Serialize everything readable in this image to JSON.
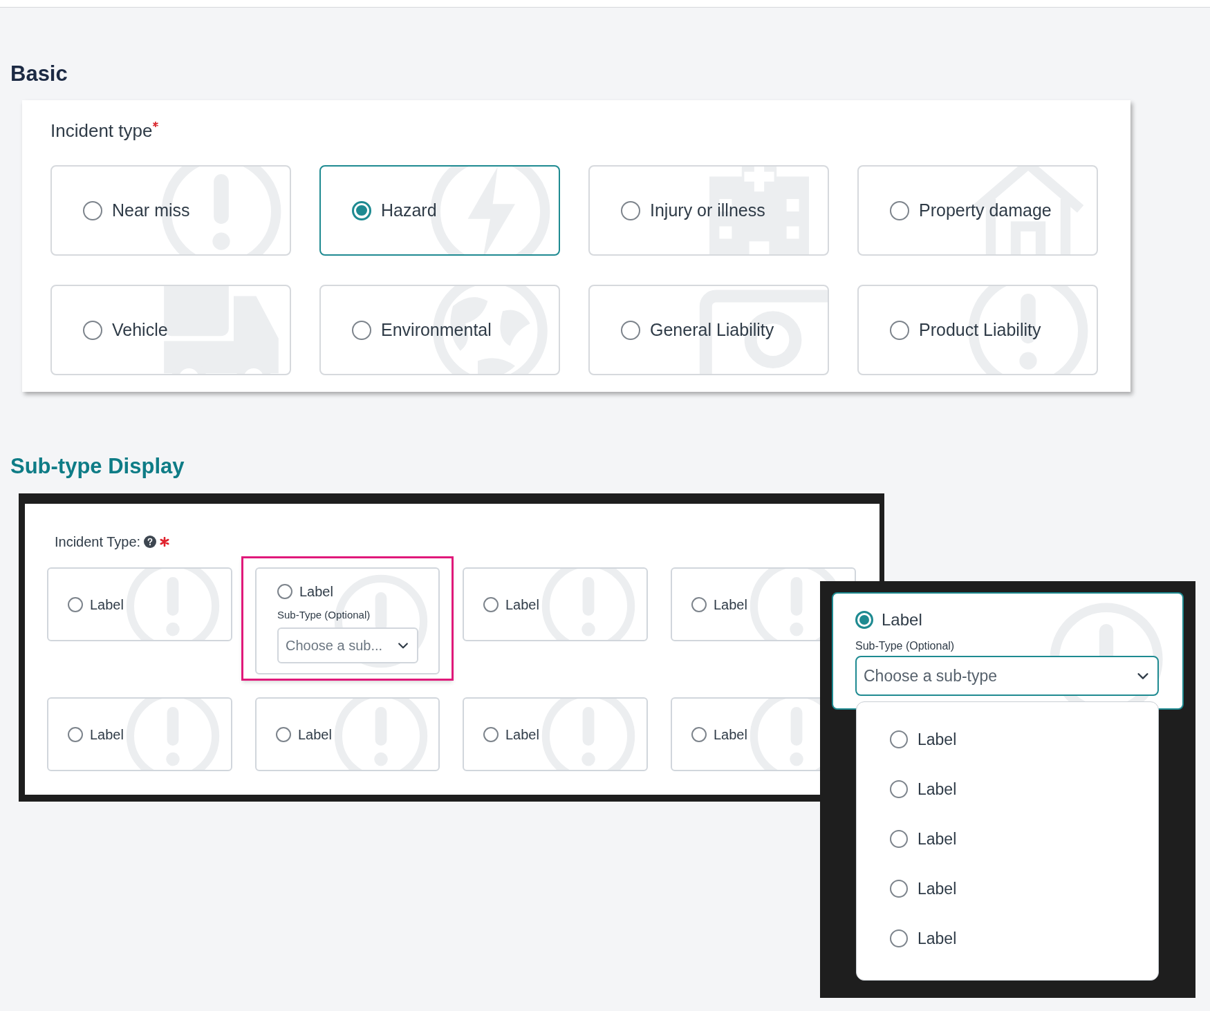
{
  "basic": {
    "heading": "Basic",
    "field": {
      "label": "Incident type",
      "required": true
    },
    "options": [
      {
        "label": "Near miss",
        "selected": false
      },
      {
        "label": "Hazard",
        "selected": true
      },
      {
        "label": "Injury or illness",
        "selected": false
      },
      {
        "label": "Property damage",
        "selected": false
      },
      {
        "label": "Vehicle",
        "selected": false
      },
      {
        "label": "Environmental",
        "selected": false
      },
      {
        "label": "General Liability",
        "selected": false
      },
      {
        "label": "Product Liability",
        "selected": false
      }
    ]
  },
  "subtype_display": {
    "heading": "Sub-type Display",
    "field": {
      "label": "Incident Type:",
      "required": true,
      "help": true
    },
    "options": [
      {
        "label": "Label",
        "selected": false
      },
      {
        "label": "Label",
        "selected": false,
        "highlighted": true,
        "subtype": {
          "label": "Sub-Type (Optional)",
          "placeholder": "Choose a sub..."
        }
      },
      {
        "label": "Label",
        "selected": false
      },
      {
        "label": "Label",
        "selected": false
      },
      {
        "label": "Label",
        "selected": false
      },
      {
        "label": "Label",
        "selected": false
      },
      {
        "label": "Label",
        "selected": false
      },
      {
        "label": "Label",
        "selected": false
      }
    ],
    "expanded_view": {
      "option": {
        "label": "Label",
        "selected": true
      },
      "subtype": {
        "label": "Sub-Type (Optional)",
        "placeholder": "Choose a sub-type",
        "expanded": true
      },
      "menu_items": [
        {
          "label": "Label",
          "selected": false
        },
        {
          "label": "Label",
          "selected": false
        },
        {
          "label": "Label",
          "selected": false
        },
        {
          "label": "Label",
          "selected": false
        },
        {
          "label": "Label",
          "selected": false
        }
      ]
    }
  }
}
